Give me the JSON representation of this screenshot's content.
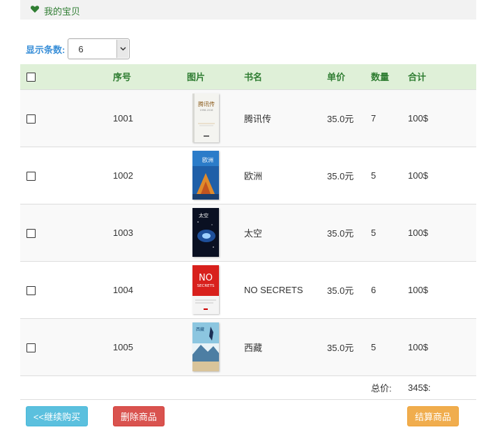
{
  "header": {
    "title": "我的宝贝",
    "icon": "heart-icon"
  },
  "page_size": {
    "label": "显示条数:",
    "value": "6"
  },
  "table": {
    "columns": [
      "序号",
      "图片",
      "书名",
      "单价",
      "数量",
      "合计"
    ],
    "rows": [
      {
        "id": "1001",
        "name": "腾讯传",
        "price": "35.0元",
        "qty": "7",
        "subtotal": "100$"
      },
      {
        "id": "1002",
        "name": "欧洲",
        "price": "35.0元",
        "qty": "5",
        "subtotal": "100$"
      },
      {
        "id": "1003",
        "name": "太空",
        "price": "35.0元",
        "qty": "5",
        "subtotal": "100$"
      },
      {
        "id": "1004",
        "name": "NO SECRETS",
        "price": "35.0元",
        "qty": "6",
        "subtotal": "100$"
      },
      {
        "id": "1005",
        "name": "西藏",
        "price": "35.0元",
        "qty": "5",
        "subtotal": "100$"
      }
    ],
    "total_label": "总价:",
    "total_value": "345$:"
  },
  "covers": {
    "c1": {
      "title": "腾讯传",
      "sub": "1998-2016"
    },
    "c2": {
      "title": "欧洲"
    },
    "c3": {
      "title": "太空"
    },
    "c4": {
      "title": "NO",
      "sub": "SECRETS"
    },
    "c5": {
      "title": "西藏"
    }
  },
  "buttons": {
    "continue": "<<继续购买",
    "delete": "删除商品",
    "checkout": "结算商品"
  },
  "colors": {
    "header_green": "#2f7d32",
    "label_blue": "#3a8fd8",
    "th_bg": "#dff0d8",
    "info": "#5bc0de",
    "danger": "#d9534f",
    "warning": "#f0ad4e"
  }
}
